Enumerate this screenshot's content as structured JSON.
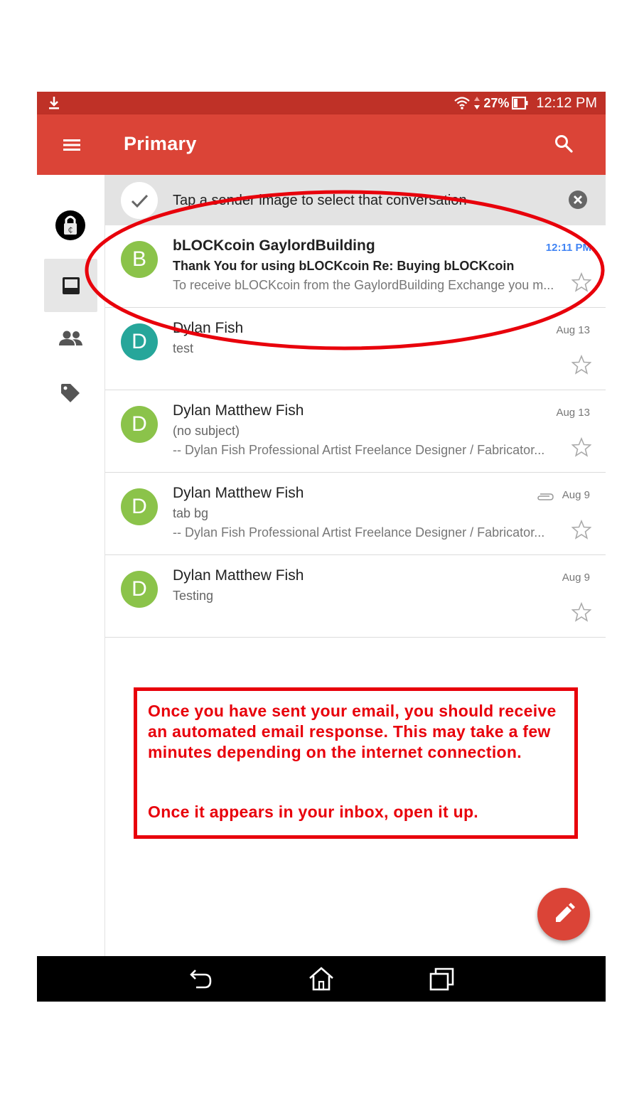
{
  "status_bar": {
    "battery": "27%",
    "time": "12:12 PM"
  },
  "app_bar": {
    "title": "Primary"
  },
  "tip": {
    "text": "Tap a sender image to select that conversation"
  },
  "emails": [
    {
      "avatar_letter": "B",
      "avatar_color": "#8bc34a",
      "sender": "bLOCKcoin GaylordBuilding",
      "subject": "Thank You for using bLOCKcoin Re: Buying bLOCKcoin",
      "snippet": "To receive bLOCKcoin from the GaylordBuilding Exchange you m...",
      "date": "12:11 PM",
      "unread": true
    },
    {
      "avatar_letter": "D",
      "avatar_color": "#26a69a",
      "sender": "Dylan Fish",
      "subject": "test",
      "snippet": "",
      "date": "Aug 13",
      "unread": false
    },
    {
      "avatar_letter": "D",
      "avatar_color": "#8bc34a",
      "sender": "Dylan Matthew Fish",
      "subject": "(no subject)",
      "snippet": "-- Dylan Fish Professional Artist Freelance Designer / Fabricator...",
      "date": "Aug 13",
      "unread": false
    },
    {
      "avatar_letter": "D",
      "avatar_color": "#8bc34a",
      "sender": "Dylan Matthew Fish",
      "subject": "tab bg",
      "snippet": "-- Dylan Fish Professional Artist Freelance Designer / Fabricator...",
      "date": "Aug 9",
      "unread": false,
      "attachment": true
    },
    {
      "avatar_letter": "D",
      "avatar_color": "#8bc34a",
      "sender": "Dylan Matthew Fish",
      "subject": "Testing",
      "snippet": "",
      "date": "Aug 9",
      "unread": false
    }
  ],
  "annotation": {
    "line1": "Once you have sent your email, you should receive an automated email response.  This may take a few minutes depending on the internet connection.",
    "line2": "Once it appears in your inbox, open it up."
  },
  "colors": {
    "status_bar": "#bf3127",
    "app_bar": "#db4437",
    "annotation_red": "#e8000b",
    "unread_date": "#4285f4"
  }
}
